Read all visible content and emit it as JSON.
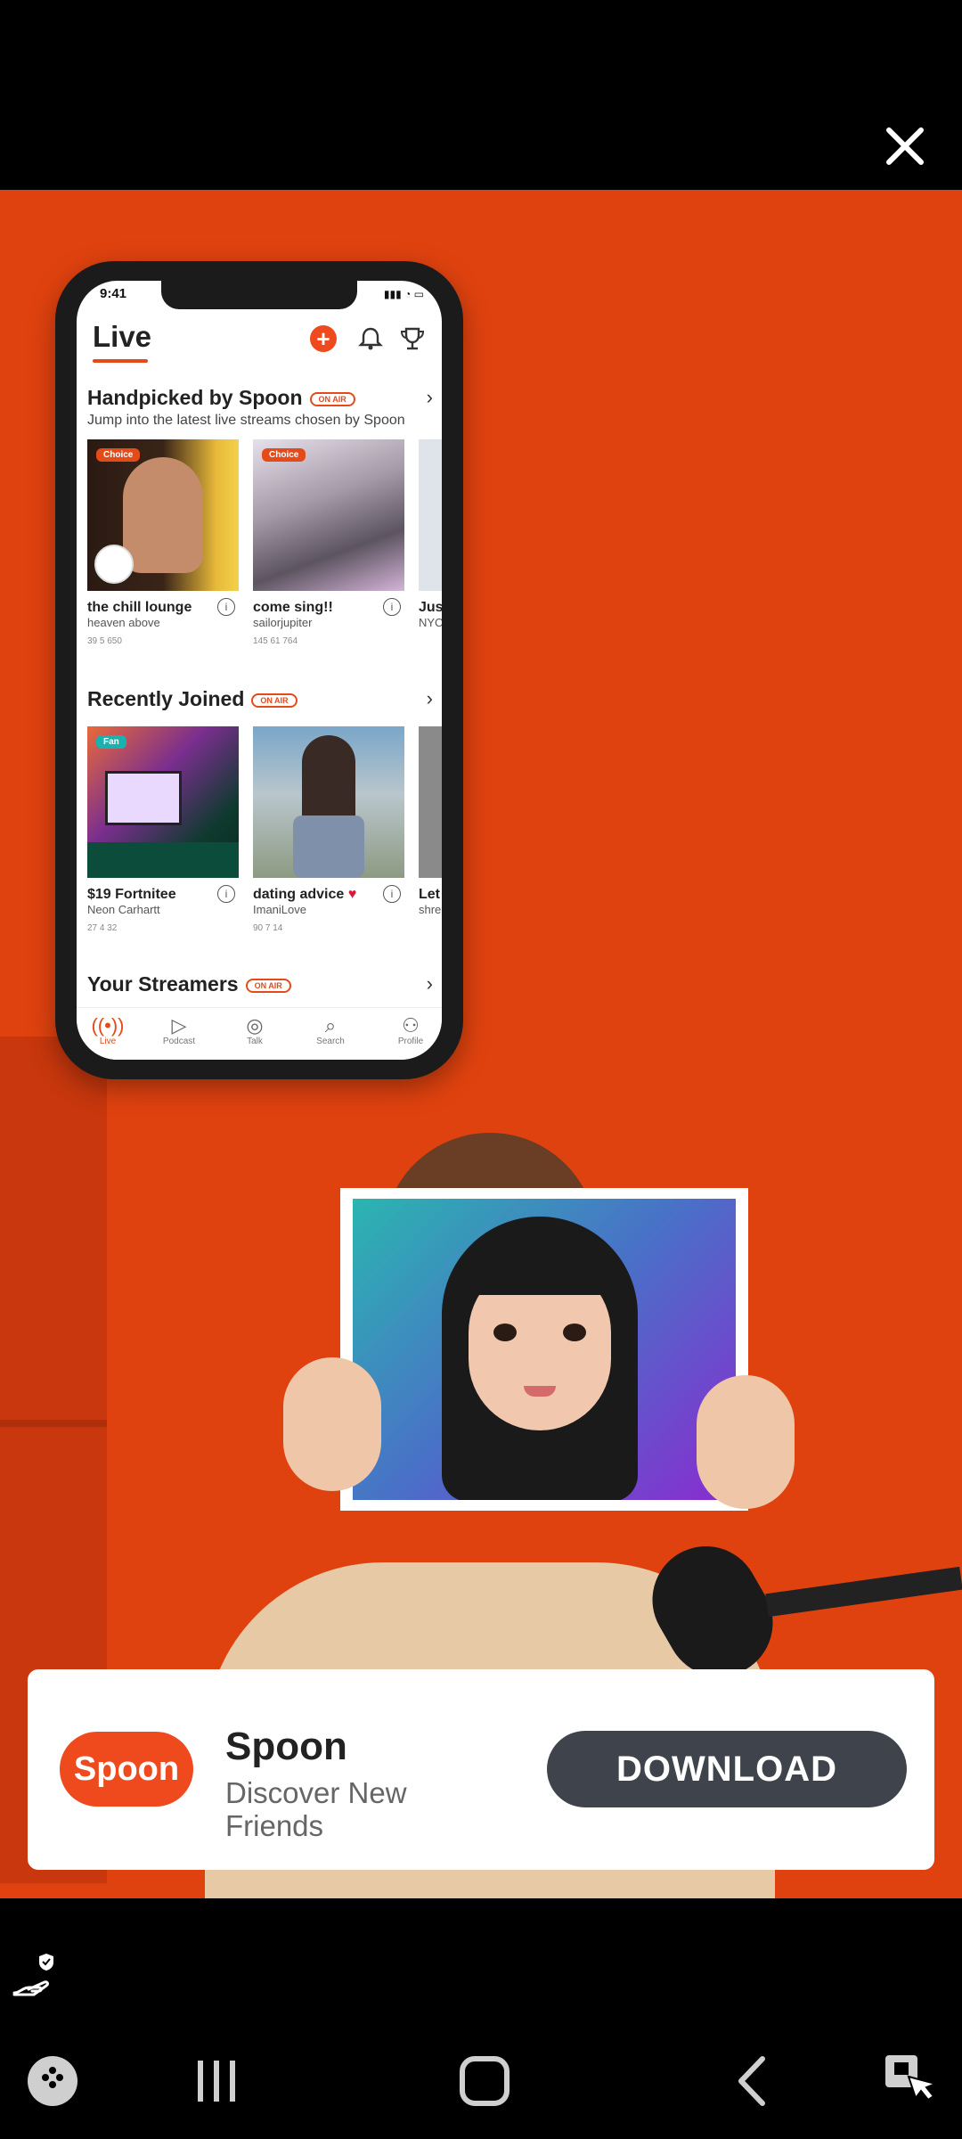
{
  "overlay": {
    "close_icon": "close-icon"
  },
  "phone": {
    "status_time": "9:41",
    "screen_title": "Live",
    "header_icons": [
      "plus-icon",
      "bell-icon",
      "trophy-icon"
    ],
    "sections": [
      {
        "title": "Handpicked by Spoon",
        "badge": "ON AIR",
        "subtitle": "Jump into the latest live streams chosen by Spoon",
        "cards": [
          {
            "tag": "Choice",
            "title": "the chill lounge",
            "user": "heaven above",
            "stats": "39  5  650"
          },
          {
            "tag": "Choice",
            "title": "come sing!!",
            "user": "sailorjupiter",
            "stats": "145  61  764"
          },
          {
            "title": "Jus",
            "user": "NYC"
          }
        ]
      },
      {
        "title": "Recently Joined",
        "badge": "ON AIR",
        "cards": [
          {
            "tag": "Fan",
            "title": "$19 Fortnitee",
            "user": "Neon Carhartt",
            "stats": "27  4  32"
          },
          {
            "title": "dating advice",
            "user": "ImaniLove",
            "stats": "90  7  14"
          },
          {
            "title": "Let",
            "user": "shre"
          }
        ]
      },
      {
        "title": "Your Streamers",
        "badge": "ON AIR"
      }
    ],
    "tabs": [
      "Live",
      "Podcast",
      "Talk",
      "Search",
      "Profile"
    ]
  },
  "banner": {
    "logo_text": "Spoon",
    "app_name": "Spoon",
    "description": "Discover New Friends",
    "cta": "DOWNLOAD"
  },
  "system_nav": {
    "icons": [
      "game-launcher-icon",
      "recent-apps-icon",
      "home-icon",
      "back-icon",
      "accessibility-icon"
    ]
  },
  "colors": {
    "accent": "#e0420f",
    "brand": "#ee4a1e",
    "cta_bg": "#3e434c"
  }
}
